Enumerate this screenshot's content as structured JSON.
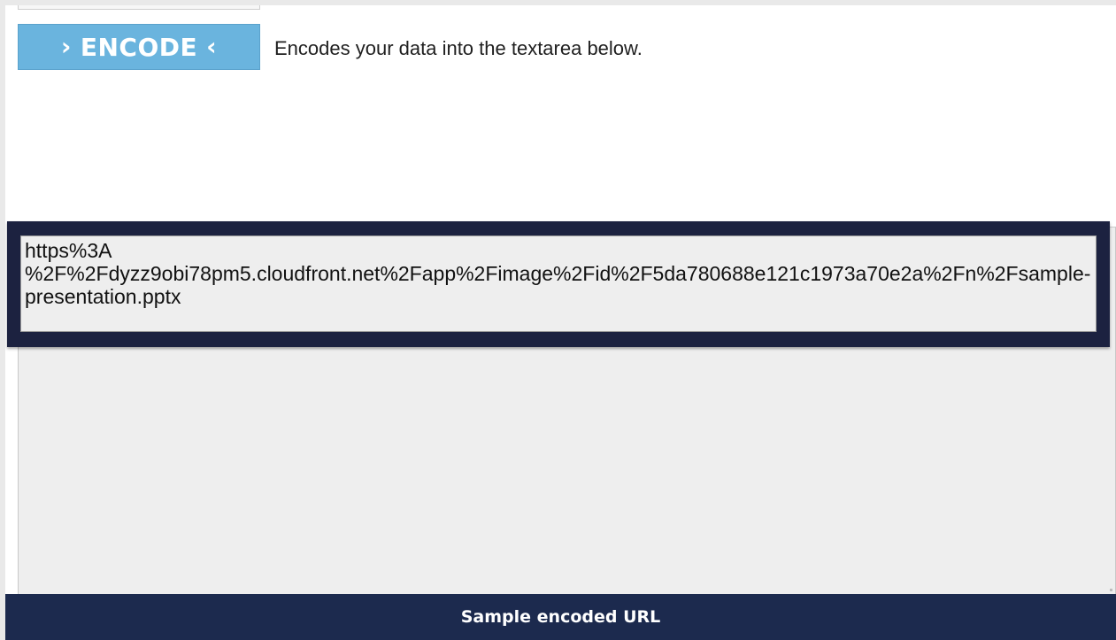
{
  "encode_button": {
    "chevron_left_icon": "›",
    "label": "ENCODE",
    "chevron_right_icon": "‹"
  },
  "encode_description": "Encodes your data into the textarea below.",
  "output": {
    "value": "https%3A\n%2F%2Fdyzz9obi78pm5.cloudfront.net%2Fapp%2Fimage%2Fid%2F5da780688e121c1973a70e2a%2Fn%2Fsample-presentation.pptx"
  },
  "caption": "Sample encoded URL",
  "colors": {
    "button": "#6ab4de",
    "highlight_frame": "#1c2240",
    "caption_bar": "#1c2a4e",
    "textarea": "#eeeeee"
  }
}
